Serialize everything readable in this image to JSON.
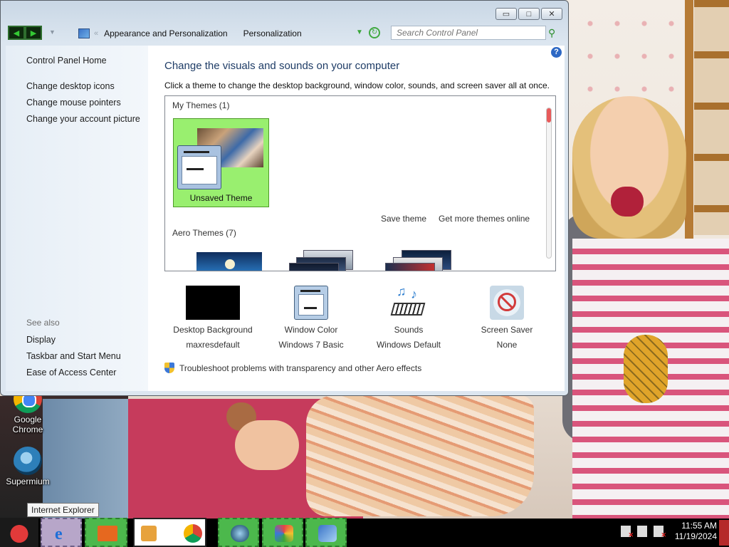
{
  "window": {
    "buttons": {
      "minimize": "▭",
      "maximize": "□",
      "close": "✕"
    },
    "breadcrumb": [
      "Appearance and Personalization",
      "Personalization"
    ],
    "breadcrumb_prefix": "«",
    "search_placeholder": "Search Control Panel"
  },
  "sidebar": {
    "home": "Control Panel Home",
    "links": [
      "Change desktop icons",
      "Change mouse pointers",
      "Change your account picture"
    ],
    "see_also_label": "See also",
    "see_also": [
      "Display",
      "Taskbar and Start Menu",
      "Ease of Access Center"
    ]
  },
  "main": {
    "heading": "Change the visuals and sounds on your computer",
    "subheading": "Click a theme to change the desktop background, window color, sounds, and screen saver all at once.",
    "my_themes_label": "My Themes (1)",
    "selected_theme": "Unsaved Theme",
    "save_theme": "Save theme",
    "get_more": "Get more themes online",
    "aero_themes_label": "Aero Themes (7)",
    "options": [
      {
        "label": "Desktop Background",
        "value": "maxresdefault"
      },
      {
        "label": "Window Color",
        "value": "Windows 7 Basic"
      },
      {
        "label": "Sounds",
        "value": "Windows Default"
      },
      {
        "label": "Screen Saver",
        "value": "None"
      }
    ],
    "troubleshoot": "Troubleshoot problems with transparency and other Aero effects"
  },
  "desktop": {
    "icons": [
      "Google Chrome",
      "Supermium"
    ],
    "tooltip": "Internet Explorer"
  },
  "taskbar": {
    "time": "11:55 AM",
    "date": "11/19/2024"
  }
}
